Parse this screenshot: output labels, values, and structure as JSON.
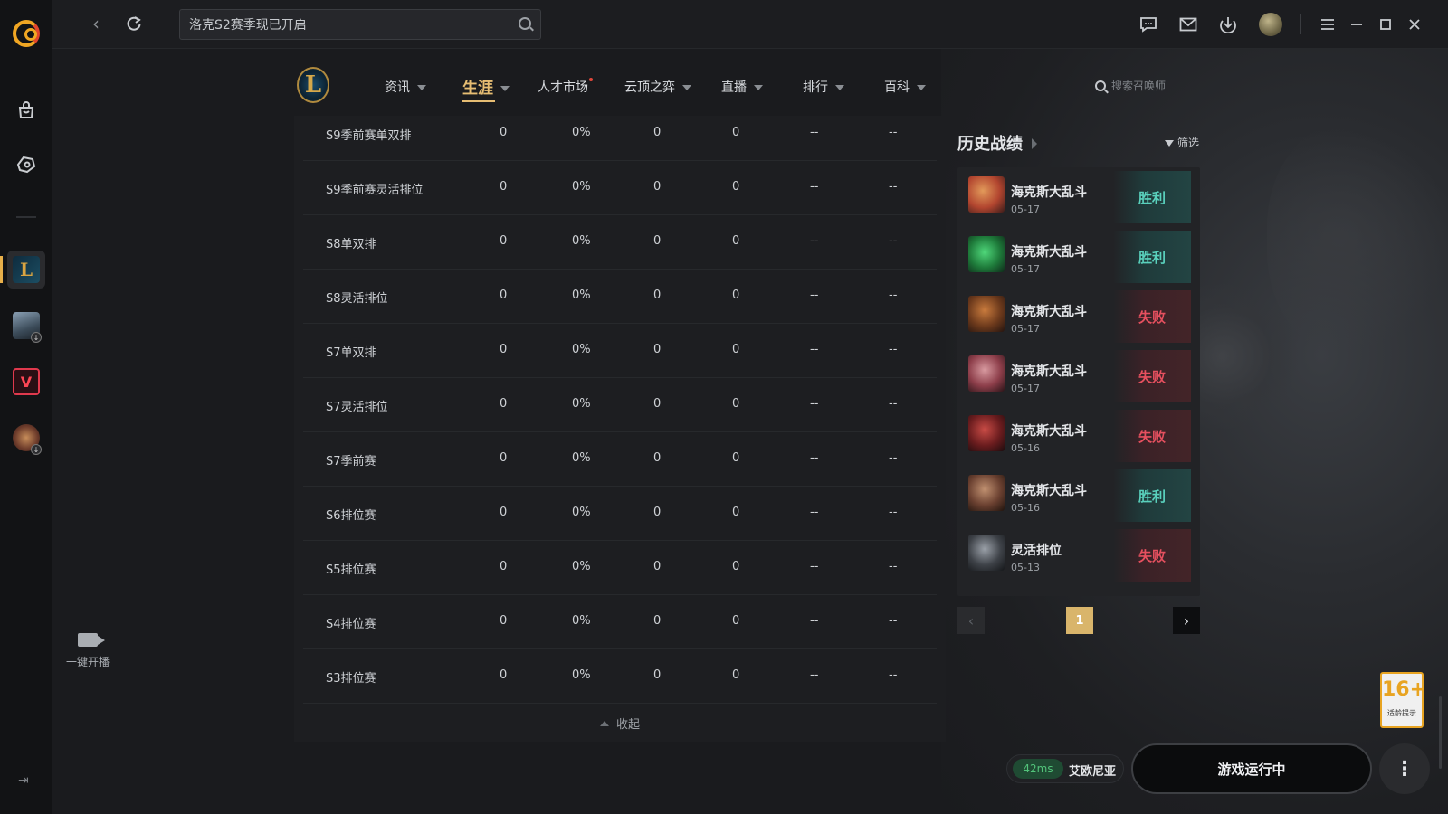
{
  "topbar": {
    "search_value": "洛克S2赛季现已开启"
  },
  "rail": {
    "live_label": "一键开播"
  },
  "subnav": {
    "logo_letter": "L",
    "items": [
      {
        "label": "资讯"
      },
      {
        "label": "生涯"
      },
      {
        "label": "人才市场"
      },
      {
        "label": "云顶之弈"
      },
      {
        "label": "直播"
      },
      {
        "label": "排行"
      },
      {
        "label": "百科"
      }
    ],
    "summoner_search_placeholder": "搜索召唤师"
  },
  "table": {
    "rows": [
      {
        "name": "S9季前赛单双排",
        "c1": "0",
        "c2": "0%",
        "c3": "0",
        "c4": "0",
        "c5": "--",
        "c6": "--"
      },
      {
        "name": "S9季前赛灵活排位",
        "c1": "0",
        "c2": "0%",
        "c3": "0",
        "c4": "0",
        "c5": "--",
        "c6": "--"
      },
      {
        "name": "S8单双排",
        "c1": "0",
        "c2": "0%",
        "c3": "0",
        "c4": "0",
        "c5": "--",
        "c6": "--"
      },
      {
        "name": "S8灵活排位",
        "c1": "0",
        "c2": "0%",
        "c3": "0",
        "c4": "0",
        "c5": "--",
        "c6": "--"
      },
      {
        "name": "S7单双排",
        "c1": "0",
        "c2": "0%",
        "c3": "0",
        "c4": "0",
        "c5": "--",
        "c6": "--"
      },
      {
        "name": "S7灵活排位",
        "c1": "0",
        "c2": "0%",
        "c3": "0",
        "c4": "0",
        "c5": "--",
        "c6": "--"
      },
      {
        "name": "S7季前赛",
        "c1": "0",
        "c2": "0%",
        "c3": "0",
        "c4": "0",
        "c5": "--",
        "c6": "--"
      },
      {
        "name": "S6排位赛",
        "c1": "0",
        "c2": "0%",
        "c3": "0",
        "c4": "0",
        "c5": "--",
        "c6": "--"
      },
      {
        "name": "S5排位赛",
        "c1": "0",
        "c2": "0%",
        "c3": "0",
        "c4": "0",
        "c5": "--",
        "c6": "--"
      },
      {
        "name": "S4排位赛",
        "c1": "0",
        "c2": "0%",
        "c3": "0",
        "c4": "0",
        "c5": "--",
        "c6": "--"
      },
      {
        "name": "S3排位赛",
        "c1": "0",
        "c2": "0%",
        "c3": "0",
        "c4": "0",
        "c5": "--",
        "c6": "--"
      }
    ],
    "collapse_label": "收起"
  },
  "history": {
    "title": "历史战绩",
    "filter_label": "筛选",
    "matches": [
      {
        "mode": "海克斯大乱斗",
        "date": "05-17",
        "result": "胜利",
        "outcome": "win"
      },
      {
        "mode": "海克斯大乱斗",
        "date": "05-17",
        "result": "胜利",
        "outcome": "win"
      },
      {
        "mode": "海克斯大乱斗",
        "date": "05-17",
        "result": "失败",
        "outcome": "loss"
      },
      {
        "mode": "海克斯大乱斗",
        "date": "05-17",
        "result": "失败",
        "outcome": "loss"
      },
      {
        "mode": "海克斯大乱斗",
        "date": "05-16",
        "result": "失败",
        "outcome": "loss"
      },
      {
        "mode": "海克斯大乱斗",
        "date": "05-16",
        "result": "胜利",
        "outcome": "win"
      },
      {
        "mode": "灵活排位",
        "date": "05-13",
        "result": "失败",
        "outcome": "loss"
      }
    ],
    "current_page": "1"
  },
  "footer": {
    "ping": "42ms",
    "server": "艾欧尼亚",
    "run_label": "游戏运行中",
    "age_rating": "16+",
    "age_tip": "适龄提示"
  },
  "colors": {
    "accent_gold": "#e6bd73",
    "win": "#5ad1bd",
    "loss": "#e5505f"
  }
}
